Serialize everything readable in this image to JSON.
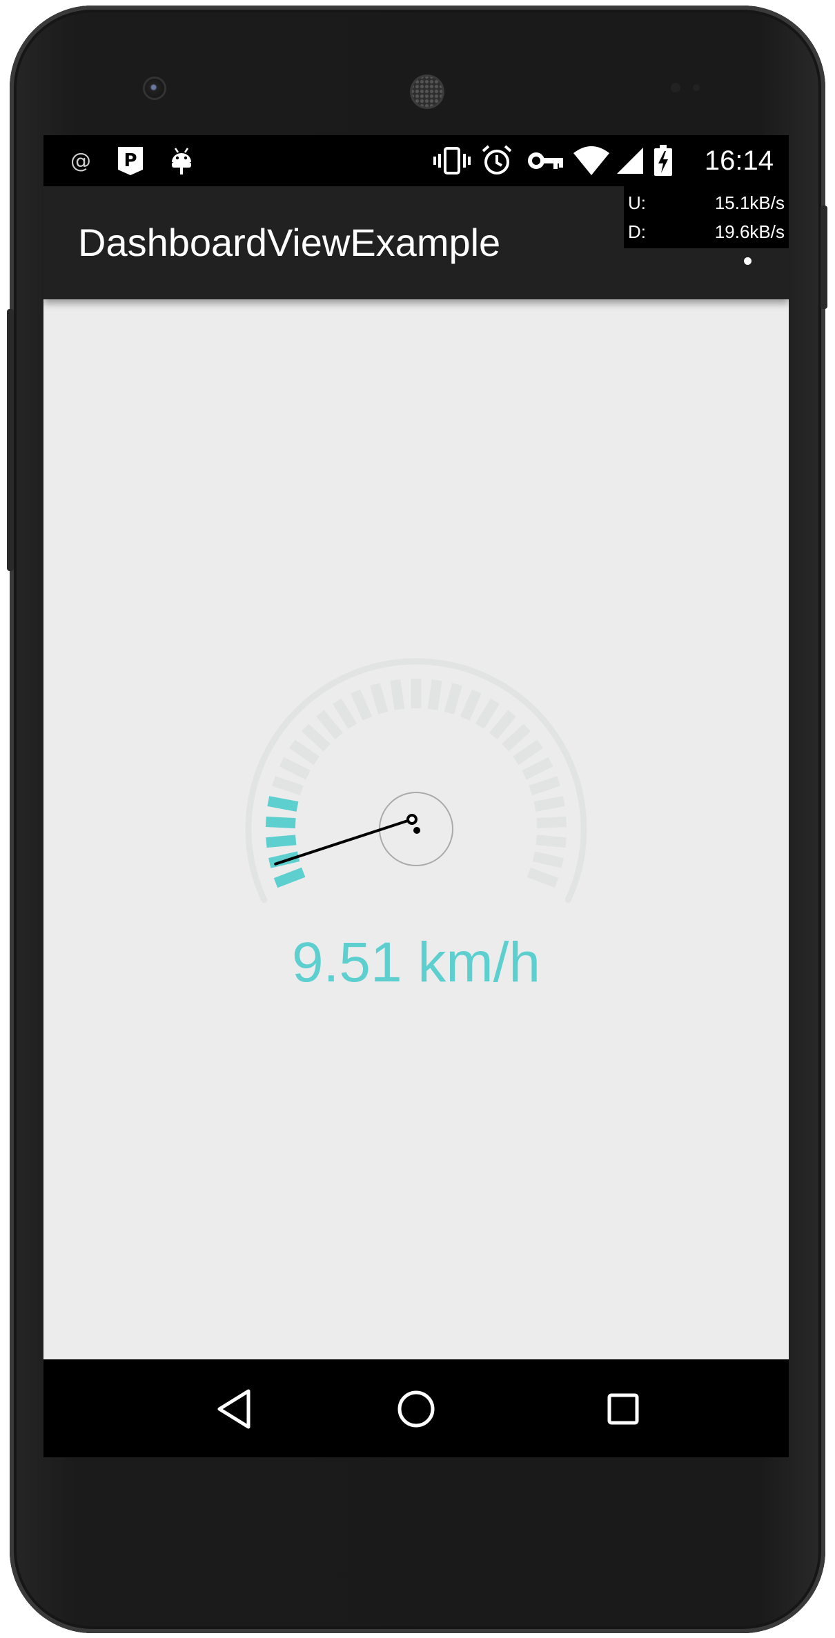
{
  "status_bar": {
    "time": "16:14",
    "left_icons": [
      "at-sign-icon",
      "parking-p-icon",
      "android-debug-icon"
    ],
    "right_icons": [
      "vibrate-icon",
      "alarm-icon",
      "vpn-key-icon",
      "wifi-icon",
      "cell-signal-icon",
      "battery-charging-icon"
    ]
  },
  "net_speed": {
    "upload_label": "U:",
    "upload_value": "15.1kB/s",
    "download_label": "D:",
    "download_value": "19.6kB/s"
  },
  "app_bar": {
    "title": "DashboardViewExample",
    "menu_icon": "more-vert-icon"
  },
  "dashboard": {
    "speed_text": "9.51 km/h",
    "needle_value_fraction": 0.048,
    "active_ticks": 5,
    "total_ticks": 29,
    "accent_color": "#5ecfcf",
    "inactive_color": "#e2e4e4",
    "needle_color": "#000000"
  },
  "nav_bar": {
    "back_icon": "back-triangle-icon",
    "home_icon": "home-circle-icon",
    "recents_icon": "recents-square-icon"
  },
  "colors": {
    "status_bar_bg": "#000000",
    "app_bar_bg": "#212121",
    "screen_bg": "#ececec",
    "nav_bar_bg": "#000000"
  }
}
